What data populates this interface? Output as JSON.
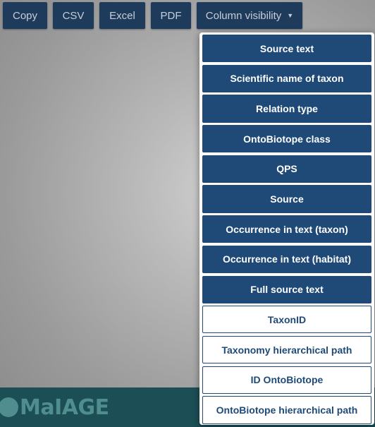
{
  "toolbar": {
    "buttons": [
      {
        "label": "Copy"
      },
      {
        "label": "CSV"
      },
      {
        "label": "Excel"
      },
      {
        "label": "PDF"
      },
      {
        "label": "Column visibility",
        "icon": "caret-down-icon",
        "caret": "▼"
      }
    ]
  },
  "logo": {
    "text": "MaIAGE"
  },
  "column_visibility": {
    "items": [
      {
        "label": "Source text",
        "visible": true
      },
      {
        "label": "Scientific name of taxon",
        "visible": true
      },
      {
        "label": "Relation type",
        "visible": true
      },
      {
        "label": "OntoBiotope class",
        "visible": true
      },
      {
        "label": "QPS",
        "visible": true
      },
      {
        "label": "Source",
        "visible": true
      },
      {
        "label": "Occurrence in text (taxon)",
        "visible": true
      },
      {
        "label": "Occurrence in text (habitat)",
        "visible": true
      },
      {
        "label": "Full source text",
        "visible": true
      },
      {
        "label": "TaxonID",
        "visible": false
      },
      {
        "label": "Taxonomy hierarchical path",
        "visible": false
      },
      {
        "label": "ID OntoBiotope",
        "visible": false
      },
      {
        "label": "OntoBiotope hierarchical path",
        "visible": false
      }
    ]
  },
  "colors": {
    "button_bg": "#1f3b5c",
    "active_item_bg": "#1f4a77",
    "footer_band": "#1b4f55",
    "logo": "#4f8d8e"
  }
}
